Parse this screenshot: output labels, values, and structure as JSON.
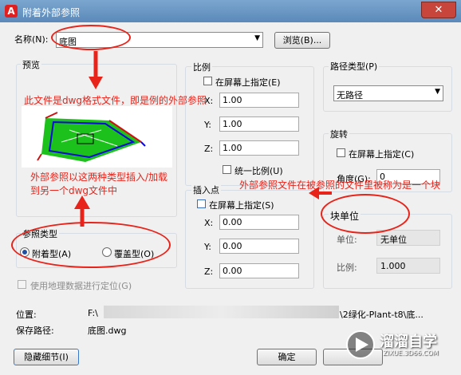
{
  "window": {
    "title": "附着外部参照",
    "close_glyph": "✕"
  },
  "name_row": {
    "label": "名称(N):",
    "value": "底图",
    "browse_label": "浏览(B)..."
  },
  "preview": {
    "title": "预览"
  },
  "scale": {
    "title": "比例",
    "on_screen_label": "在屏幕上指定(E)",
    "x_label": "X:",
    "x_value": "1.00",
    "y_label": "Y:",
    "y_value": "1.00",
    "z_label": "Z:",
    "z_value": "1.00",
    "uniform_label": "统一比例(U)"
  },
  "insertion": {
    "title": "插入点",
    "on_screen_label": "在屏幕上指定(S)",
    "x_label": "X:",
    "x_value": "0.00",
    "y_label": "Y:",
    "y_value": "0.00",
    "z_label": "Z:",
    "z_value": "0.00"
  },
  "path_type": {
    "title": "路径类型(P)",
    "value": "无路径"
  },
  "rotation": {
    "title": "旋转",
    "on_screen_label": "在屏幕上指定(C)",
    "angle_label": "角度(G):",
    "angle_value": "0"
  },
  "block_unit": {
    "title": "块单位",
    "unit_label": "单位:",
    "unit_value": "无单位",
    "ratio_label": "比例:",
    "ratio_value": "1.000"
  },
  "reference_type": {
    "title": "参照类型",
    "attach_label": "附着型(A)",
    "overlay_label": "覆盖型(O)"
  },
  "geo_label": "使用地理数据进行定位(G)",
  "location": {
    "label": "位置:",
    "value_start": "F:\\",
    "value_end": "\\2绿化-Plant-t8\\底..."
  },
  "save_path": {
    "label": "保存路径:",
    "value": "底图.dwg"
  },
  "buttons": {
    "hide_details": "隐藏细节(I)",
    "ok": "确定"
  },
  "annotations": {
    "file_note": "此文件是dwg格式文件，即是例的外部参照",
    "insert_note_line1": "外部参照以这两种类型插入/加载",
    "insert_note_line2": "到另一个dwg文件中",
    "block_note": "外部参照文件在被参照的文件里被称为是一个块"
  },
  "watermark": {
    "brand": "溜溜自学",
    "url": "ZIXUE.3D66.COM"
  },
  "colors": {
    "annotation": "#e8231a",
    "titlebar": "#6b96c4"
  }
}
